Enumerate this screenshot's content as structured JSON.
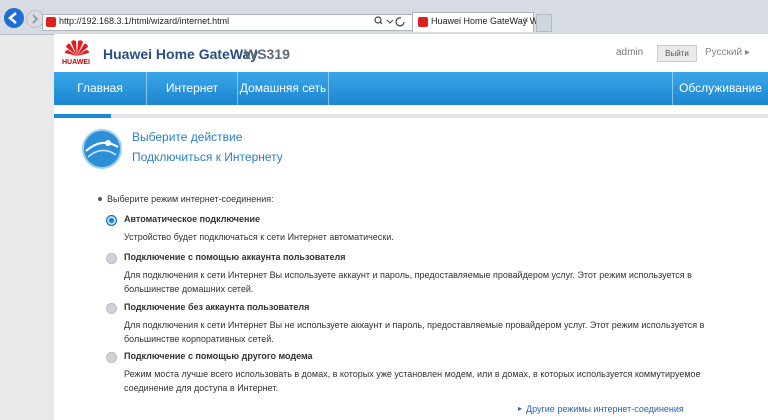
{
  "browser": {
    "url": "http://192.168.3.1/html/wizard/internet.html",
    "tab_title": "Huawei Home GateWay WS...",
    "close_glyph": "×"
  },
  "header": {
    "logo_text": "HUAWEI",
    "brand": "Huawei Home GateWay",
    "model": "WS319",
    "user": "admin",
    "logout_label": "Выйти",
    "language": "Русский ▸"
  },
  "menu": {
    "items": [
      "Главная",
      "Интернет",
      "Домашняя сеть"
    ],
    "right_item": "Обслуживание"
  },
  "wizard": {
    "progress": 0.08,
    "step_title": "Выберите действие",
    "step_subtitle": "Подключиться к Интернету"
  },
  "mode_label": "Выберите режим интернет-соединения:",
  "options": [
    {
      "title": "Автоматическое подключение",
      "desc": "Устройство будет подключаться к сети Интернет автоматически.",
      "selected": true
    },
    {
      "title": "Подключение с помощью аккаунта пользователя",
      "desc": "Для подключения к сети Интернет Вы используете аккаунт и пароль, предоставляемые провайдером услуг. Этот режим используется в большинстве домашних сетей.",
      "selected": false
    },
    {
      "title": "Подключение без аккаунта пользователя",
      "desc": "Для подключения к сети Интернет Вы не используете аккаунт и пароль, предоставляемые провайдером услуг. Этот режим используется в большинстве корпоративных сетей.",
      "selected": false
    },
    {
      "title": "Подключение с помощью другого модема",
      "desc": "Режим моста лучше всего использовать в домах, в которых уже установлен модем, или в домах, в которых используется коммутируемое соединение для доступа в Интернет.",
      "selected": false
    }
  ],
  "other_modes_link": "Другие режимы интернет-соединения",
  "colors": {
    "accent": "#1a8ad6",
    "brand_red": "#e02020",
    "link": "#2166b5"
  }
}
